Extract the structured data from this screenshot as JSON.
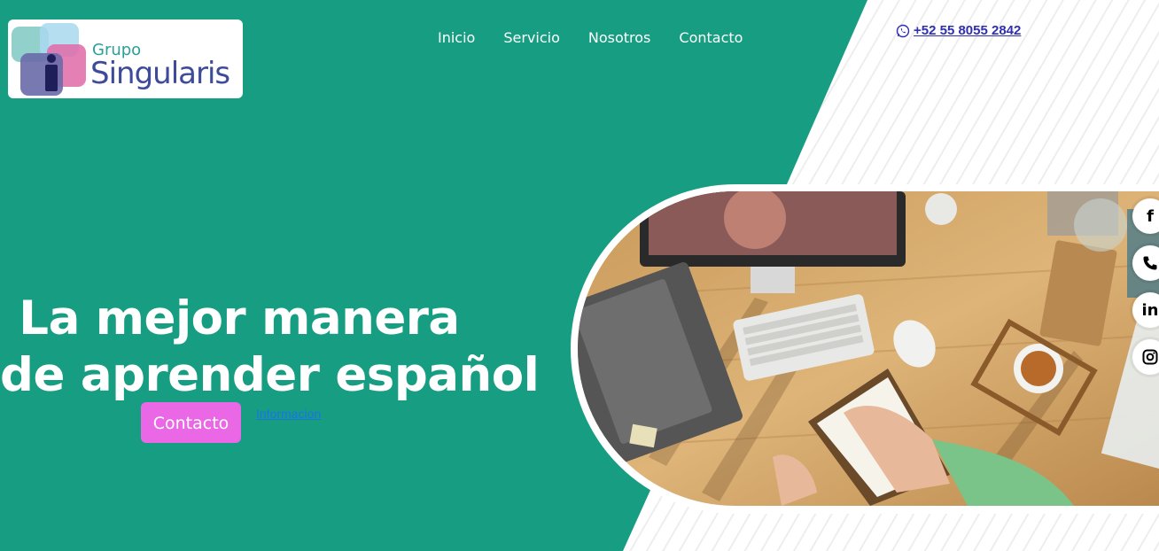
{
  "logo": {
    "small_text": "Grupo",
    "big_text": "Singularis"
  },
  "nav": {
    "items": [
      "Inicio",
      "Servicio",
      "Nosotros",
      "Contacto"
    ]
  },
  "phone": {
    "number": "+52 55 8055 2842",
    "icon": "whatsapp-icon"
  },
  "hero": {
    "title_line1": "La mejor manera",
    "title_line2": "de aprender español",
    "button_label": "Contacto",
    "link_label": "Informacion"
  },
  "social": {
    "facebook_glyph": "f",
    "linkedin_glyph": "in",
    "icons": [
      "facebook-icon",
      "phone-icon",
      "linkedin-icon",
      "instagram-icon"
    ]
  },
  "colors": {
    "brand_green": "#179e82",
    "button_pink": "#ea68e6",
    "phone_link": "#3030b0",
    "logo_teal": "#2c9f9a",
    "logo_indigo": "#3d4b9a"
  }
}
